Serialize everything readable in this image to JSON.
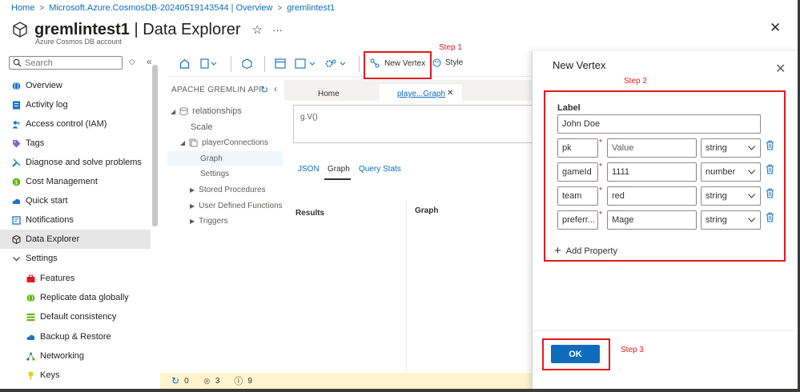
{
  "breadcrumb": {
    "home": "Home",
    "account": "Microsoft.Azure.CosmosDB-20240519143544 | Overview",
    "resource": "gremlintest1"
  },
  "header": {
    "title_bold": "gremlintest1",
    "title_rest": " | Data Explorer",
    "subtitle": "Azure Cosmos DB account",
    "favorite_icon": "star-icon",
    "more_label": "···"
  },
  "search": {
    "placeholder": "Search"
  },
  "sidebar": {
    "items": [
      {
        "label": "Overview",
        "icon": "globe-icon"
      },
      {
        "label": "Activity log",
        "icon": "log-icon"
      },
      {
        "label": "Access control (IAM)",
        "icon": "people-icon"
      },
      {
        "label": "Tags",
        "icon": "tag-icon"
      },
      {
        "label": "Diagnose and solve problems",
        "icon": "wrench-icon"
      },
      {
        "label": "Cost Management",
        "icon": "cost-icon"
      },
      {
        "label": "Quick start",
        "icon": "cloud-icon"
      },
      {
        "label": "Notifications",
        "icon": "notification-icon"
      },
      {
        "label": "Data Explorer",
        "icon": "cube-icon"
      },
      {
        "label": "Settings",
        "icon": "chevron-down-icon"
      },
      {
        "label": "Features",
        "icon": "toolbox-icon"
      },
      {
        "label": "Replicate data globally",
        "icon": "globe-icon"
      },
      {
        "label": "Default consistency",
        "icon": "bars-icon"
      },
      {
        "label": "Backup & Restore",
        "icon": "backup-icon"
      },
      {
        "label": "Networking",
        "icon": "network-icon"
      },
      {
        "label": "Keys",
        "icon": "key-icon"
      }
    ],
    "active": "Data Explorer"
  },
  "toolbar": {
    "new_vertex": "New Vertex",
    "style": "Style"
  },
  "tree": {
    "header": "APACHE GREMLIN API",
    "database": "relationships",
    "scale": "Scale",
    "graph_name": "playerConnections",
    "graph": "Graph",
    "settings": "Settings",
    "stored_procedures": "Stored Procedures",
    "udfs": "User Defined Functions",
    "triggers": "Triggers"
  },
  "tabs": {
    "home": "Home",
    "graph": "playe...Graph",
    "close": "✕"
  },
  "query": {
    "text": "g.V()"
  },
  "result_tabs": {
    "json": "JSON",
    "graph": "Graph",
    "query_stats": "Query Stats"
  },
  "results": {
    "results_label": "Results",
    "graph_label": "Graph"
  },
  "status": {
    "count_a": "0",
    "count_b": "3",
    "count_c": "9"
  },
  "panel": {
    "title": "New Vertex",
    "label_heading": "Label",
    "label_value": "John Doe",
    "properties": [
      {
        "key": "pk",
        "value": "",
        "placeholder": "Value",
        "type": "string"
      },
      {
        "key": "gameId",
        "value": "1111",
        "placeholder": "",
        "type": "number"
      },
      {
        "key": "team",
        "value": "red",
        "placeholder": "",
        "type": "string"
      },
      {
        "key": "preferr...",
        "value": "Mage",
        "placeholder": "",
        "type": "string"
      }
    ],
    "add_property": "Add Property",
    "ok": "OK"
  },
  "annotations": {
    "step1": "Step 1",
    "step2": "Step 2",
    "step3": "Step 3"
  },
  "colors": {
    "accent": "#0f6cbd",
    "annotation": "#e3191f",
    "status_bar": "#fff4ce"
  }
}
